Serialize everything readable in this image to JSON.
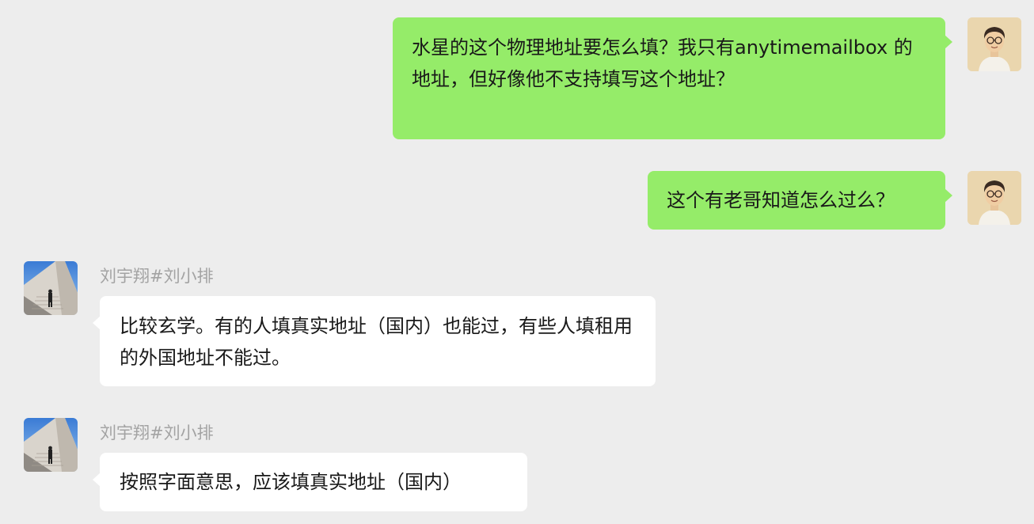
{
  "colors": {
    "background": "#ededed",
    "outgoing_bubble": "#95ec69",
    "incoming_bubble": "#ffffff",
    "sender_name": "#a3a3a3"
  },
  "messages": [
    {
      "direction": "outgoing",
      "avatar_icon": "cartoon-man-with-glasses-avatar",
      "text": "水星的这个物理地址要怎么填？我只有anytimemailbox 的地址，但好像他不支持填写这个地址？"
    },
    {
      "direction": "outgoing",
      "avatar_icon": "cartoon-man-with-glasses-avatar",
      "text": "这个有老哥知道怎么过么？"
    },
    {
      "direction": "incoming",
      "sender": "刘宇翔#刘小排",
      "avatar_icon": "person-on-stairs-photo-avatar",
      "text": "比较玄学。有的人填真实地址（国内）也能过，有些人填租用的外国地址不能过。"
    },
    {
      "direction": "incoming",
      "sender": "刘宇翔#刘小排",
      "avatar_icon": "person-on-stairs-photo-avatar",
      "text": "按照字面意思，应该填真实地址（国内）"
    }
  ]
}
